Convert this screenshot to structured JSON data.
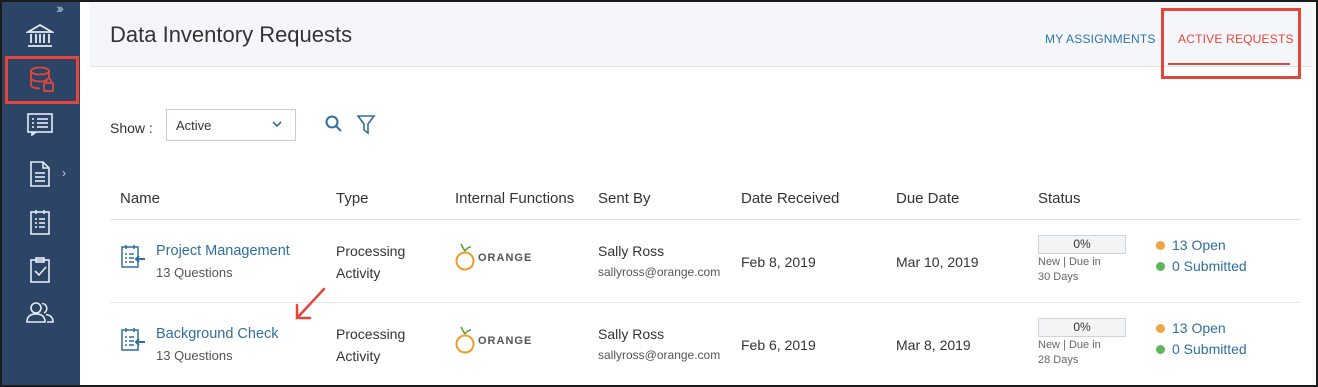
{
  "header": {
    "title": "Data Inventory Requests",
    "tabs": [
      {
        "label": "MY ASSIGNMENTS",
        "active": false
      },
      {
        "label": "ACTIVE REQUESTS",
        "active": true
      }
    ]
  },
  "sidebar": {
    "expand_icon": "double-chevron-right-icon",
    "items": [
      {
        "icon": "bank-icon",
        "active": false
      },
      {
        "icon": "database-lock-icon",
        "active": true
      },
      {
        "icon": "list-icon",
        "active": false
      },
      {
        "icon": "document-icon",
        "active": false,
        "has_submenu": true
      },
      {
        "icon": "calendar-list-icon",
        "active": false
      },
      {
        "icon": "clipboard-check-icon",
        "active": false
      },
      {
        "icon": "users-icon",
        "active": false
      }
    ]
  },
  "filters": {
    "show_label": "Show :",
    "show_value": "Active",
    "search_icon": "search-icon",
    "filter_icon": "filter-icon"
  },
  "table": {
    "columns": [
      "Name",
      "Type",
      "Internal Functions",
      "Sent By",
      "Date Received",
      "Due Date",
      "Status"
    ],
    "rows": [
      {
        "name": "Project Management",
        "questions": "13 Questions",
        "type_line1": "Processing",
        "type_line2": "Activity",
        "org": "ORANGE",
        "sender_name": "Sally Ross",
        "sender_email": "sallyross@orange.com",
        "date_received": "Feb 8, 2019",
        "due_date": "Mar 10, 2019",
        "progress_label": "0%",
        "progress": 0,
        "status_line1": "New | Due in",
        "status_line2": "30 Days",
        "open": "13 Open",
        "submitted": "0 Submitted"
      },
      {
        "name": "Background Check",
        "questions": "13 Questions",
        "type_line1": "Processing",
        "type_line2": "Activity",
        "org": "ORANGE",
        "sender_name": "Sally Ross",
        "sender_email": "sallyross@orange.com",
        "date_received": "Feb 6, 2019",
        "due_date": "Mar 8, 2019",
        "progress_label": "0%",
        "progress": 0,
        "status_line1": "New | Due in",
        "status_line2": "28 Days",
        "open": "13 Open",
        "submitted": "0 Submitted"
      }
    ]
  },
  "colors": {
    "sidebar_bg": "#2c4466",
    "accent_red": "#e4473a",
    "link_blue": "#2f6fa0",
    "open_dot": "#f0a444",
    "submitted_dot": "#5cb85c"
  }
}
